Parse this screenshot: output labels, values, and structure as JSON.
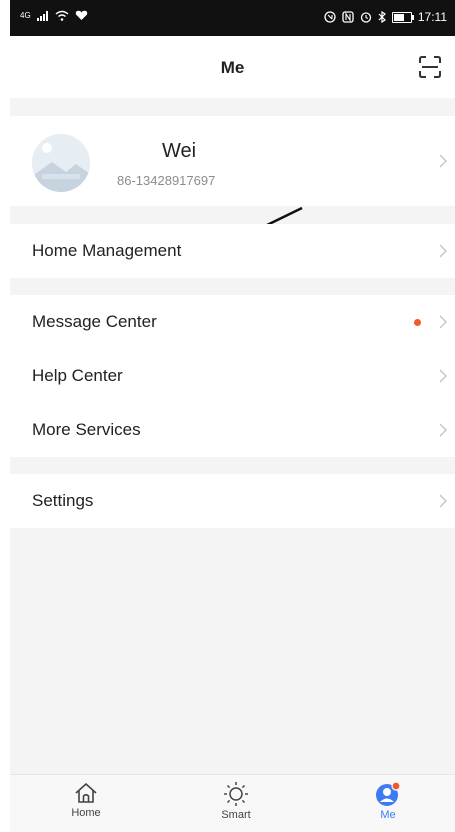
{
  "status_bar": {
    "signal_text": "4G",
    "time": "17:11",
    "icons": [
      "signal-icon",
      "wifi-icon",
      "heart-icon",
      "nfc-icon",
      "alarm-icon",
      "bluetooth-icon",
      "battery-icon"
    ]
  },
  "header": {
    "title": "Me",
    "scan_icon": "scan-icon"
  },
  "profile": {
    "name": "Wei",
    "phone": "86-13428917697"
  },
  "menu": {
    "home_management": "Home Management",
    "message_center": "Message Center",
    "help_center": "Help Center",
    "more_services": "More Services",
    "settings": "Settings"
  },
  "tabs": [
    {
      "label": "Home",
      "icon": "home-icon",
      "active": false
    },
    {
      "label": "Smart",
      "icon": "sun-icon",
      "active": false
    },
    {
      "label": "Me",
      "icon": "person-icon",
      "active": true
    }
  ],
  "colors": {
    "accent": "#3b7cf5",
    "badge": "#f05a28",
    "background": "#f4f4f4"
  }
}
